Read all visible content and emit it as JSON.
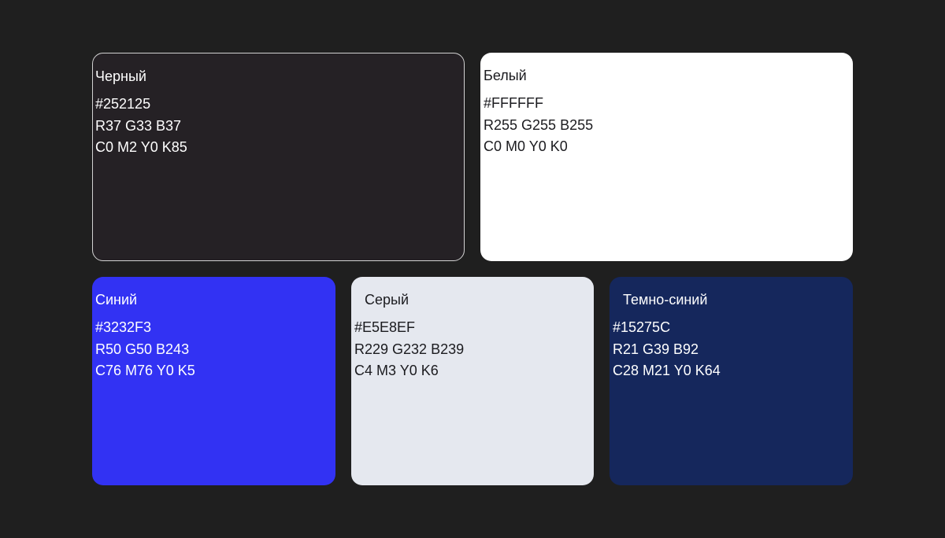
{
  "swatches": [
    {
      "name": "Черный",
      "hex": "#252125",
      "rgb": "R37 G33 B37",
      "cmyk": "C0 M2 Y0 K85",
      "fill": "#252125"
    },
    {
      "name": "Белый",
      "hex": "#FFFFFF",
      "rgb": "R255 G255 B255",
      "cmyk": "C0 M0 Y0 K0",
      "fill": "#FFFFFF"
    },
    {
      "name": "Синий",
      "hex": "#3232F3",
      "rgb": "R50 G50 B243",
      "cmyk": "C76 M76 Y0 K5",
      "fill": "#3232F3"
    },
    {
      "name": "Серый",
      "hex": "#E5E8EF",
      "rgb": "R229 G232 B239",
      "cmyk": "C4 M3 Y0 K6",
      "fill": "#E5E8EF"
    },
    {
      "name": "Темно-синий",
      "hex": "#15275C",
      "rgb": "R21 G39 B92",
      "cmyk": "C28 M21 Y0 K64",
      "fill": "#15275C"
    }
  ],
  "colors": {
    "page_background": "#1f1f1f",
    "light_text": "#ffffff",
    "dark_text": "#1b1b1f"
  }
}
